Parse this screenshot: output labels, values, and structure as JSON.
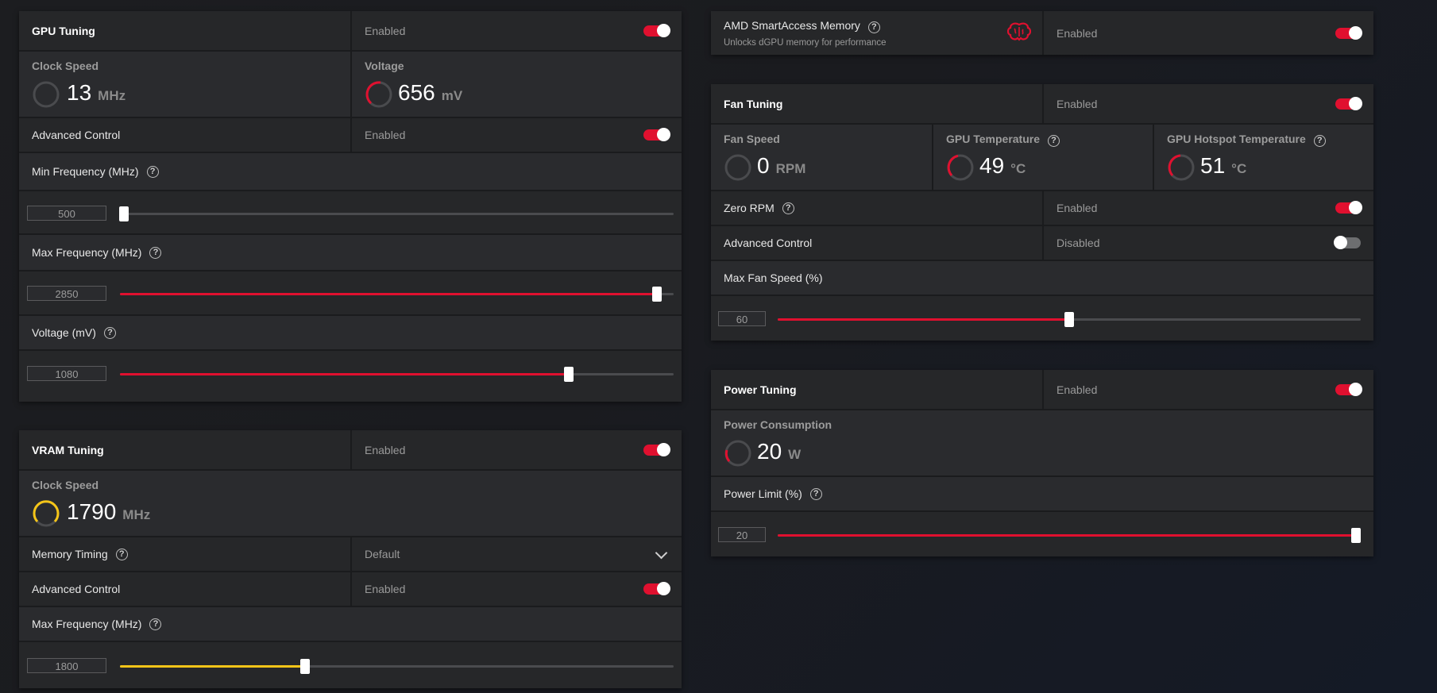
{
  "colors": {
    "accent": "#e0102f",
    "vram_accent": "#f5c518",
    "toggle_off": "#6d6e70"
  },
  "gpu_tuning": {
    "title": "GPU Tuning",
    "state": "Enabled",
    "clock_speed": {
      "label": "Clock Speed",
      "value": "13",
      "unit": "MHz"
    },
    "voltage": {
      "label": "Voltage",
      "value": "656",
      "unit": "mV"
    },
    "advanced_control": {
      "label": "Advanced Control",
      "state": "Enabled"
    },
    "min_freq": {
      "label": "Min Frequency (MHz)",
      "value": "500",
      "fraction": 0.0
    },
    "max_freq": {
      "label": "Max Frequency (MHz)",
      "value": "2850",
      "fraction": 0.97
    },
    "voltage_slider": {
      "label": "Voltage (mV)",
      "value": "1080",
      "fraction": 0.81
    }
  },
  "vram_tuning": {
    "title": "VRAM Tuning",
    "state": "Enabled",
    "clock_speed": {
      "label": "Clock Speed",
      "value": "1790",
      "unit": "MHz"
    },
    "memory_timing": {
      "label": "Memory Timing",
      "value": "Default"
    },
    "advanced_control": {
      "label": "Advanced Control",
      "state": "Enabled"
    },
    "max_freq": {
      "label": "Max Frequency (MHz)",
      "value": "1800",
      "fraction": 0.335
    }
  },
  "sam": {
    "title": "AMD SmartAccess Memory",
    "subtitle": "Unlocks dGPU memory for performance",
    "state": "Enabled",
    "icon": "brain-icon"
  },
  "fan_tuning": {
    "title": "Fan Tuning",
    "state": "Enabled",
    "fan_speed": {
      "label": "Fan Speed",
      "value": "0",
      "unit": "RPM"
    },
    "gpu_temp": {
      "label": "GPU Temperature",
      "value": "49",
      "unit": "°C"
    },
    "hotspot_temp": {
      "label": "GPU Hotspot Temperature",
      "value": "51",
      "unit": "°C"
    },
    "zero_rpm": {
      "label": "Zero RPM",
      "state": "Enabled"
    },
    "advanced_control": {
      "label": "Advanced Control",
      "state": "Disabled"
    },
    "max_fan_speed": {
      "label": "Max Fan Speed (%)",
      "value": "60",
      "fraction": 0.5
    }
  },
  "power_tuning": {
    "title": "Power Tuning",
    "state": "Enabled",
    "power_consumption": {
      "label": "Power Consumption",
      "value": "20",
      "unit": "W"
    },
    "power_limit": {
      "label": "Power Limit (%)",
      "value": "20",
      "fraction": 1.0
    }
  },
  "help_glyph": "?"
}
